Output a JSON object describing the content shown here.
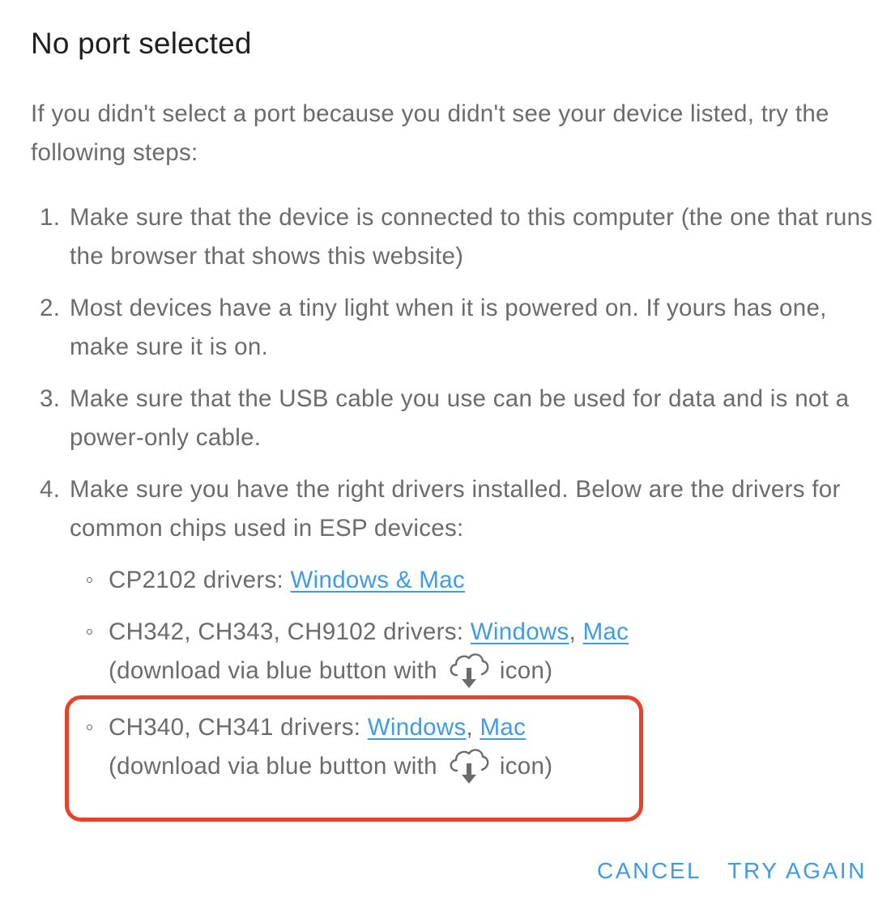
{
  "dialog": {
    "title": "No port selected",
    "intro": "If you didn't select a port because you didn't see your device listed, try the following steps:",
    "steps": [
      {
        "num": "1.",
        "text": "Make sure that the device is connected to this computer (the one that runs the browser that shows this website)"
      },
      {
        "num": "2.",
        "text": "Most devices have a tiny light when it is powered on. If yours has one, make sure it is on."
      },
      {
        "num": "3.",
        "text": "Make sure that the USB cable you use can be used for data and is not a power-only cable."
      },
      {
        "num": "4.",
        "text": "Make sure you have the right drivers installed. Below are the drivers for common chips used in ESP devices:"
      }
    ],
    "drivers": [
      {
        "label": "CP2102 drivers: ",
        "link1": "Windows & Mac"
      },
      {
        "label": "CH342, CH343, CH9102 drivers: ",
        "link1": "Windows",
        "sep": ", ",
        "link2": "Mac",
        "note_before": "(download via blue button with ",
        "note_after": " icon)",
        "note_icon": "cloud-download-icon"
      },
      {
        "label": "CH340, CH341 drivers: ",
        "link1": "Windows",
        "sep": ", ",
        "link2": "Mac",
        "note_before": "(download via blue button with ",
        "note_after": " icon)",
        "note_icon": "cloud-download-icon"
      }
    ],
    "highlight_color": "#e8432a",
    "buttons": {
      "cancel": "CANCEL",
      "try_again": "TRY AGAIN"
    }
  },
  "colors": {
    "title": "#1f1f1f",
    "body_text": "#6b6b6b",
    "link": "#3d9be9",
    "accent": "#3d9be9"
  }
}
